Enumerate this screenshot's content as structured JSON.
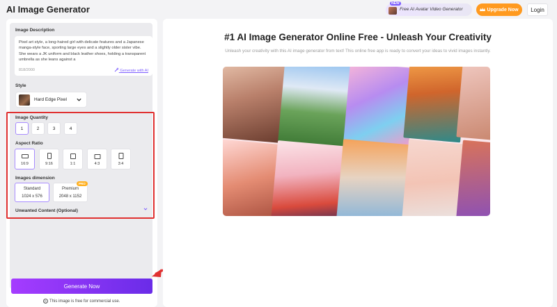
{
  "header": {
    "title": "AI Image Generator",
    "promo_badge": "NEW",
    "promo_text": "Free AI Avatar Video Generator",
    "upgrade_label": "Upgrade Now",
    "login_label": "Login"
  },
  "form": {
    "description_label": "Image Description",
    "description_text": "Pixel art style, a long-haired girl with delicate features and a Japanese manga-style face, sporting large eyes and a slightly older sister vibe. She wears a JK uniform and black leather shoes, holding a transparent umbrella as she leans against a",
    "char_count": "818/2000",
    "generate_ai_label": "Generate with AI",
    "style_label": "Style",
    "style_value": "Hard Edge Pixel",
    "quantity_label": "Image Quantity",
    "quantity_options": [
      "1",
      "2",
      "3",
      "4"
    ],
    "quantity_selected": "1",
    "ratio_label": "Aspect Ratio",
    "ratio_options": [
      "16:9",
      "9:16",
      "1:1",
      "4:3",
      "3:4"
    ],
    "ratio_selected": "16:9",
    "dimension_label": "Images dimension",
    "dimensions": [
      {
        "name": "Standard",
        "size": "1024 x 576"
      },
      {
        "name": "Premium",
        "size": "2048 x 1152",
        "badge": "PRO"
      }
    ],
    "dimension_selected": "Standard",
    "unwanted_label": "Unwanted Content (Optional)"
  },
  "actions": {
    "generate_label": "Generate Now",
    "free_note": "This image is free for commercial use."
  },
  "main": {
    "title": "#1 AI Image Generator Online Free - Unleash Your Creativity",
    "subtitle": "Unleash your creativity with this AI image generator from text! This online free app is ready to convert your ideas to vivid images instantly."
  },
  "colors": {
    "accent": "#7b5cff",
    "upgrade": "#ff9a1f",
    "generate_start": "#a53cff",
    "generate_end": "#6a2ce8",
    "highlight": "#e03030"
  }
}
